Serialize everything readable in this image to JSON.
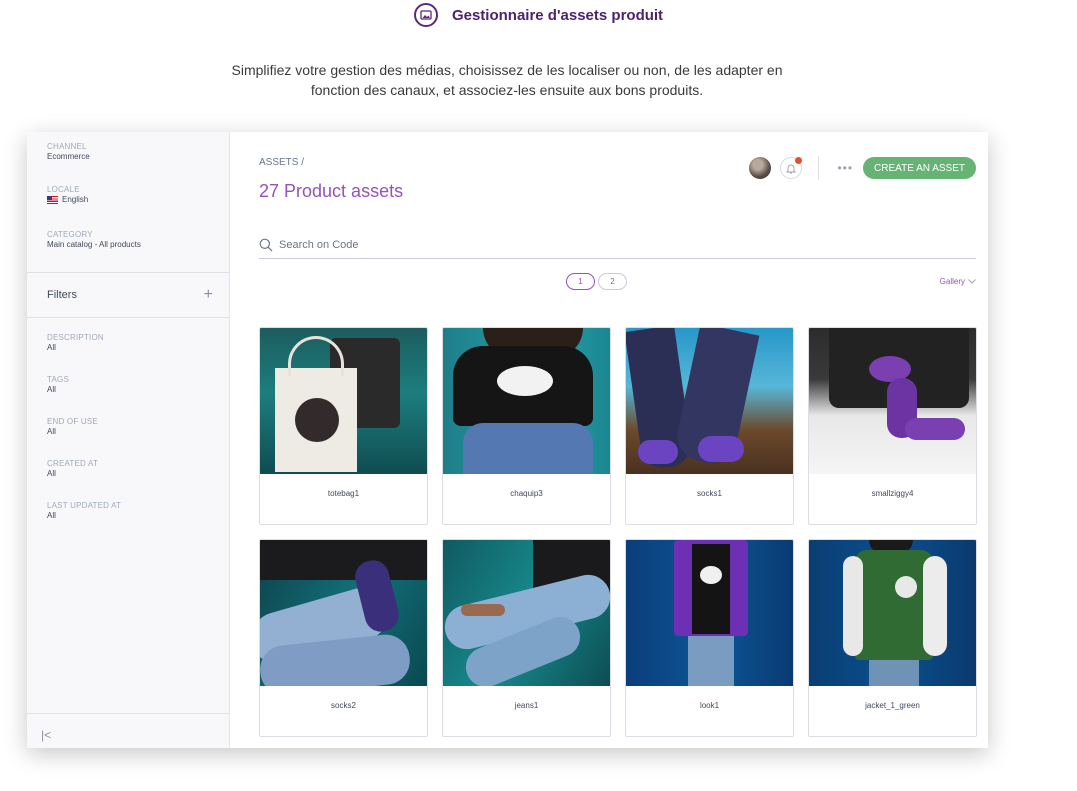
{
  "hero": {
    "title": "Gestionnaire d'assets produit",
    "icon": "image-icon",
    "description_line1": "Simplifiez votre gestion des médias, choisissez de les localiser ou non, de les adapter en",
    "description_line2": "fonction des canaux, et associez-les ensuite aux bons produits."
  },
  "sidebar": {
    "channel_label": "CHANNEL",
    "channel_value": "Ecommerce",
    "locale_label": "LOCALE",
    "locale_value": "English",
    "category_label": "CATEGORY",
    "category_value": "Main catalog - All products",
    "filters_title": "Filters",
    "filters": [
      {
        "label": "DESCRIPTION",
        "value": "All"
      },
      {
        "label": "TAGS",
        "value": "All"
      },
      {
        "label": "END OF USE",
        "value": "All"
      },
      {
        "label": "CREATED AT",
        "value": "All"
      },
      {
        "label": "LAST UPDATED AT",
        "value": "All"
      }
    ]
  },
  "main": {
    "breadcrumb": "ASSETS /",
    "title": "27 Product assets",
    "create_button": "CREATE AN ASSET",
    "search_placeholder": "Search on Code",
    "pages": [
      "1",
      "2"
    ],
    "active_page": "1",
    "view_mode": "Gallery",
    "assets": [
      {
        "code": "totebag1"
      },
      {
        "code": "chaquip3"
      },
      {
        "code": "socks1"
      },
      {
        "code": "smallziggy4"
      },
      {
        "code": "socks2"
      },
      {
        "code": "jeans1"
      },
      {
        "code": "look1"
      },
      {
        "code": "jacket_1_green"
      }
    ]
  },
  "colors": {
    "brand_purple": "#9452ba",
    "create_green": "#67b373",
    "notification_red": "#e2502f"
  }
}
